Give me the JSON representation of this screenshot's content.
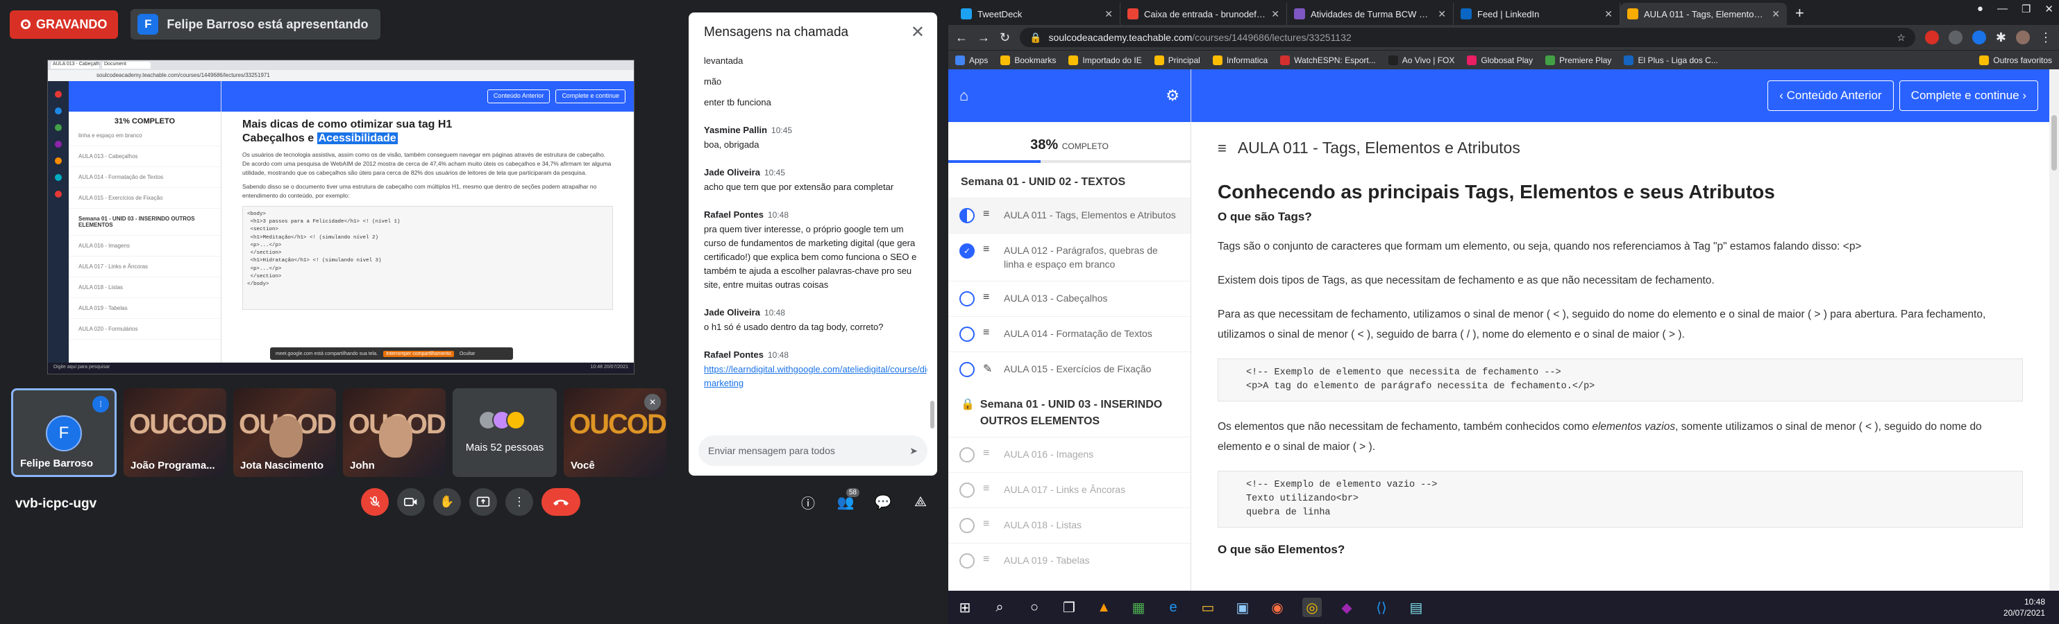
{
  "meet": {
    "recording_label": "GRAVANDO",
    "presenter_initial": "F",
    "presenter_banner": "Felipe Barroso está apresentando",
    "shared_screen": {
      "tab1": "AULA 013 - Cabeçalhos H",
      "tab2": "Document",
      "address": "soulcodeacademy.teachable.com/courses/1449686/lectures/33251971",
      "progress": "31% COMPLETO",
      "nav_prev": "Conteúdo Anterior",
      "nav_next": "Complete e continue",
      "title_line1": "Mais dicas de como otimizar sua tag H1",
      "title_line2": "Cabeçalhos e ",
      "title_highlight": "Acessibilidade",
      "para1": "Os usuários de tecnologia assistiva, assim como os de visão, também conseguem navegar em páginas através de estrutura de cabeçalho. De acordo com uma pesquisa de WebAIM de 2012 mostra de cerca de 47,4% acham muito úteis os cabeçalhos e 34,7% afirmam ter alguma utilidade, mostrando que os cabeçalhos são úteis para cerca de 82% dos usuários de leitores de tela que participaram da pesquisa.",
      "para2": "Sabendo disso se o documento tiver uma estrutura de cabeçalho com múltiplos H1, mesmo que dentro de seções podem atrapalhar no entendimento do conteúdo, por exemplo:",
      "code": "<body>\n <h1>3 passos para a Felicidade</h1> <! (nível 1)\n <section>\n <h1>Meditação</h1> <! (simulando nível 2)\n <p>...</p>\n </section>\n <h1>Hidratação</h1> <! (simulando nível 3)\n <p>...</p>\n </section>\n</body>",
      "side_items": [
        "linha e espaço em branco",
        "AULA 013 - Cabeçalhos",
        "AULA 014 - Formatação de Textos",
        "AULA 015 - Exercícios de Fixação",
        "Semana 01 - UNID 03 - INSERINDO OUTROS ELEMENTOS",
        "AULA 016 - Imagens",
        "AULA 017 - Links e Âncoras",
        "AULA 018 - Listas",
        "AULA 019 - Tabelas",
        "AULA 020 - Formulários"
      ],
      "share_text": "meet.google.com está compartilhando sua tela.",
      "share_stop": "Interromper compartilhamento",
      "share_hide": "Ocultar",
      "taskbar_search": "Digite aqui para pesquisar",
      "taskbar_time": "10:48",
      "taskbar_date": "20/07/2021"
    },
    "tiles": [
      {
        "name": "Felipe Barroso",
        "initial": "F"
      },
      {
        "name": "João Programa..."
      },
      {
        "name": "Jota Nascimento"
      },
      {
        "name": "John"
      },
      {
        "name": "Mais 52 pessoas"
      },
      {
        "name": "Você"
      }
    ],
    "tile_logo": "OUCODE",
    "meeting_code": "vvb-icpc-ugv",
    "participants_count": "58",
    "chat": {
      "title": "Mensagens na chamada",
      "messages": [
        {
          "sender": "",
          "time": "",
          "lines": [
            "levantada",
            "mão",
            "enter tb funciona"
          ]
        },
        {
          "sender": "Yasmine Pallin",
          "time": "10:45",
          "lines": [
            "boa, obrigada"
          ]
        },
        {
          "sender": "Jade Oliveira",
          "time": "10:45",
          "lines": [
            "acho que tem que por extensão para completar"
          ]
        },
        {
          "sender": "Rafael Pontes",
          "time": "10:48",
          "lines": [
            "pra quem tiver interesse, o próprio google tem um curso de fundamentos de marketing digital (que gera certificado!) que explica bem como funciona o SEO e também te ajuda a escolher palavras-chave pro seu site, entre muitas outras coisas"
          ]
        },
        {
          "sender": "Jade Oliveira",
          "time": "10:48",
          "lines": [
            "o h1 só é usado dentro da tag body, correto?"
          ]
        },
        {
          "sender": "Rafael Pontes",
          "time": "10:48",
          "link": "https://learndigital.withgoogle.com/ateliedigital/course/digital-marketing"
        }
      ],
      "input_placeholder": "Enviar mensagem para todos"
    }
  },
  "browser": {
    "tabs": [
      {
        "title": "TweetDeck",
        "color": "#1da1f2"
      },
      {
        "title": "Caixa de entrada - brunodefront...",
        "color": "#ea4335"
      },
      {
        "title": "Atividades de Turma BCW 5 - Sc...",
        "color": "#7e57c2"
      },
      {
        "title": "Feed | LinkedIn",
        "color": "#0a66c2"
      },
      {
        "title": "AULA 011 - Tags, Elementos e Atr...",
        "color": "#f9ab00",
        "active": true
      }
    ],
    "url_host": "soulcodeacademy.teachable.com",
    "url_path": "/courses/1449686/lectures/33251132",
    "bookmarks": [
      {
        "label": "Apps",
        "color": "#4285f4"
      },
      {
        "label": "Bookmarks",
        "color": "#fbbc04"
      },
      {
        "label": "Importado do IE",
        "color": "#fbbc04"
      },
      {
        "label": "Principal",
        "color": "#fbbc04"
      },
      {
        "label": "Informatica",
        "color": "#fbbc04"
      },
      {
        "label": "WatchESPN: Esport...",
        "color": "#d32f2f"
      },
      {
        "label": "Ao Vivo | FOX",
        "color": "#212121"
      },
      {
        "label": "Globosat Play",
        "color": "#e91e63"
      },
      {
        "label": "Premiere Play",
        "color": "#43a047"
      },
      {
        "label": "El Plus - Liga dos C...",
        "color": "#1565c0"
      }
    ],
    "bookmarks_other": "Outros favoritos",
    "sidebar": {
      "progress_pct": "38%",
      "progress_fraction": 0.38,
      "progress_label": "COMPLETO",
      "section1": "Semana 01 - UNID 02 - TEXTOS",
      "section2": "Semana 01 - UNID 03 - INSERINDO OUTROS ELEMENTOS",
      "items1": [
        {
          "label": "AULA 011 - Tags, Elementos e Atributos",
          "status": "half"
        },
        {
          "label": "AULA 012 - Parágrafos, quebras de linha e espaço em branco",
          "status": "done"
        },
        {
          "label": "AULA 013 - Cabeçalhos",
          "status": "todo"
        },
        {
          "label": "AULA 014 - Formatação de Textos",
          "status": "todo"
        },
        {
          "label": "AULA 015 - Exercícios de Fixação",
          "status": "todo"
        }
      ],
      "items2": [
        {
          "label": "AULA 016 - Imagens"
        },
        {
          "label": "AULA 017 - Links e Âncoras"
        },
        {
          "label": "AULA 018 - Listas"
        },
        {
          "label": "AULA 019 - Tabelas"
        }
      ]
    },
    "nav_prev": "Conteúdo Anterior",
    "nav_next": "Complete e continue",
    "lecture_title": "AULA 011 - Tags, Elementos e Atributos",
    "heading": "Conhecendo as principais Tags, Elementos e seus Atributos",
    "sub1": "O que são Tags?",
    "p1": "Tags são o conjunto de caracteres que formam um elemento, ou seja, quando nos referenciamos à Tag \"p\" estamos falando disso: <p>",
    "p2": "Existem dois tipos de Tags, as que necessitam de fechamento e as que não necessitam de fechamento.",
    "p3": "Para as que necessitam de fechamento, utilizamos o sinal de menor ( < ), seguido do nome do elemento e o sinal de maior ( > ) para abertura. Para fechamento, utilizamos o sinal de menor ( < ), seguido de barra ( / ), nome do elemento e o sinal de maior ( > ).",
    "code1_l1": "<!-- Exemplo de elemento que necessita de fechamento -->",
    "code1_l2": "<p>A tag do elemento de parágrafo necessita de fechamento.</p>",
    "p4_a": "Os elementos que não necessitam de fechamento, também conhecidos como ",
    "p4_em": "elementos vazios",
    "p4_b": ", somente utilizamos o sinal de menor ( < ), seguido do nome do elemento e o sinal de maior ( > ).",
    "code2_l1": "<!-- Exemplo de elemento vazio -->",
    "code2_l2": "Texto utilizando<br>",
    "code2_l3": "quebra de linha",
    "sub2": "O que são Elementos?",
    "clock_time": "10:48",
    "clock_date": "20/07/2021"
  }
}
